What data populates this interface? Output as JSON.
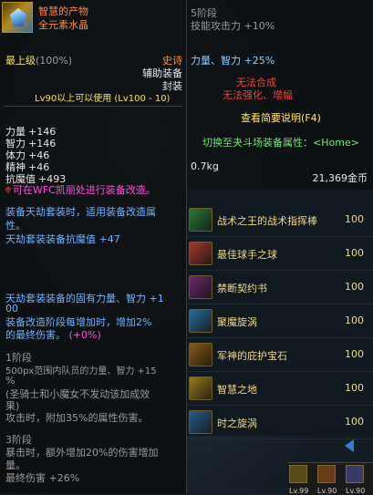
{
  "tooltip": {
    "item_name": "智慧的产物",
    "item_sub": "全元素水晶",
    "level_label": "最上级",
    "level_pct": "(100%)",
    "rarity": "史诗",
    "slot_type": "辅助装备",
    "seal": "封装",
    "level_req": "Lv90以上可以使用 (Lv100 - 10)",
    "stats": [
      {
        "label": "力量",
        "value": "+146"
      },
      {
        "label": "智力",
        "value": "+146"
      },
      {
        "label": "体力",
        "value": "+46"
      },
      {
        "label": "精神",
        "value": "+46"
      },
      {
        "label": "抗魔值",
        "value": "+493"
      }
    ],
    "wfc_note": "可在WFC凯丽处进行装备改造。",
    "set_line1": "装备天劫套装时，适用装备改造属",
    "set_line2": "性。",
    "set_line3": "天劫套装装备抗魔值 +47",
    "set_line4": "天劫套装装备的固有力量、智力 +1",
    "set_line4b": "00",
    "set_line5": "装备改造阶段每增加时，增加2%",
    "set_line6": "的最终伤害。",
    "set_line6b": "(+0%)",
    "stage1_title": "1阶段",
    "stage1_l1": "500px范围内队员的力量、智力 +15",
    "stage1_l1b": "%",
    "stage1_l2": "(圣骑士和小魔女不发动该加成效",
    "stage1_l3": "果)",
    "stage1_l4": "攻击时，附加35%的属性伤害。",
    "stage3_title": "3阶段",
    "stage3_l1": "暴击时，额外增加20%的伤害增加",
    "stage3_l2": "量。",
    "stage3_l3": "最终伤害 +26%"
  },
  "compare": {
    "stage5": "5阶段",
    "skill_atk": "技能攻击力 +10%",
    "str_int": "力量、智力 +25%",
    "cannot_combine": "无法合成",
    "cannot_enhance": "无法强化、增幅",
    "view_desc_btn": "查看简要说明(F4)",
    "switch_btn": "切换至夬斗场装备属性：<Home>",
    "weight": "0.7kg",
    "price": "21,369金币"
  },
  "inventory": [
    {
      "name": "战术之王的战术指挥棒",
      "qty": "100",
      "icon": "baton-icon",
      "color": "#2a7a3a"
    },
    {
      "name": "最佳球手之球",
      "qty": "100",
      "icon": "ball-icon",
      "color": "#a03a2a"
    },
    {
      "name": "禁断契约书",
      "qty": "100",
      "icon": "book-icon",
      "color": "#6a2a6a"
    },
    {
      "name": "聚魔旋涡",
      "qty": "100",
      "icon": "vortex-icon",
      "color": "#2a6a9a"
    },
    {
      "name": "军神的庇护宝石",
      "qty": "100",
      "icon": "gem-icon",
      "color": "#8a5a1a"
    },
    {
      "name": "智慧之地",
      "qty": "100",
      "icon": "wisdom-icon",
      "color": "#9a7a1a"
    },
    {
      "name": "时之旋涡",
      "qty": "100",
      "icon": "time-vortex-icon",
      "color": "#2a5a8a"
    }
  ],
  "skillbar": {
    "labels": [
      "Lv.99",
      "Lv.90",
      "Lv.90"
    ]
  }
}
